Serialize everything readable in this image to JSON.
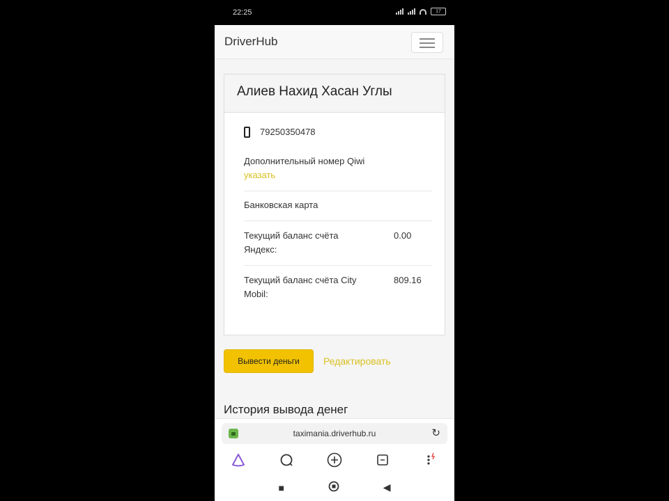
{
  "status_bar": {
    "time": "22:25",
    "battery": "17"
  },
  "navbar": {
    "brand": "DriverHub"
  },
  "profile": {
    "name": "Алиев Нахид Хасан Углы",
    "phone": "79250350478",
    "extra_number_label": "Дополнительный номер Qiwi",
    "extra_number_link": "указать",
    "bank_card_label": "Банковская карта",
    "balance_yandex_label": "Текущий баланс счёта Яндекс:",
    "balance_yandex_value": "0.00",
    "balance_citymobil_label": "Текущий баланс счёта City Mobil:",
    "balance_citymobil_value": "809.16"
  },
  "actions": {
    "withdraw_label": "Вывести деньги",
    "edit_label": "Редактировать"
  },
  "history": {
    "title": "История вывода денег"
  },
  "browser": {
    "url": "taximania.driverhub.ru"
  },
  "colors": {
    "accent": "#f2c200",
    "link": "#d9c020",
    "lock": "#6cb64c"
  }
}
